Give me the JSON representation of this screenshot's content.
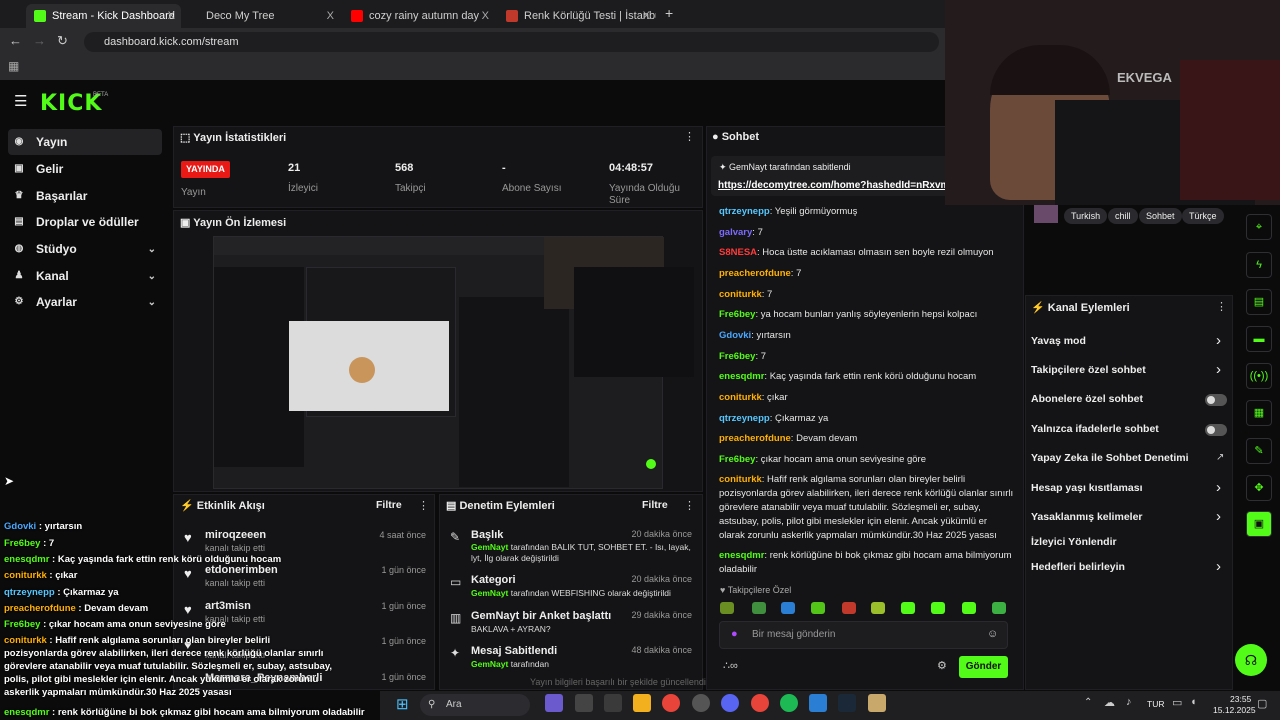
{
  "browser": {
    "tabs": [
      {
        "label": "Stream - Kick Dashboard",
        "close": "X"
      },
      {
        "label": "Deco My Tree",
        "close": "X"
      },
      {
        "label": "cozy rainy autumn day",
        "close": "X"
      },
      {
        "label": "Renk Körlüğü Testi | İstanbul Gö",
        "close": "X"
      }
    ],
    "new_tab": "+",
    "url": "dashboard.kick.com/stream"
  },
  "kick": {
    "logo": "KICK",
    "beta": "BETA",
    "sidebar": [
      {
        "label": "Yayın",
        "icon": "stream-icon"
      },
      {
        "label": "Gelir",
        "icon": "revenue-icon"
      },
      {
        "label": "Başarılar",
        "icon": "trophy-icon"
      },
      {
        "label": "Droplar ve ödüller",
        "icon": "gift-icon"
      },
      {
        "label": "Stüdyo",
        "icon": "studio-icon"
      },
      {
        "label": "Kanal",
        "icon": "channel-icon"
      },
      {
        "label": "Ayarlar",
        "icon": "settings-icon"
      }
    ],
    "stats": {
      "title": "Yayın İstatistikleri",
      "live_badge": "YAYINDA",
      "items": [
        {
          "value": "",
          "label": "Yayın"
        },
        {
          "value": "21",
          "label": "İzleyici"
        },
        {
          "value": "568",
          "label": "Takipçi"
        },
        {
          "value": "-",
          "label": "Abone Sayısı"
        },
        {
          "value": "04:48:57",
          "label": "Yayında Olduğu Süre"
        }
      ]
    },
    "preview": {
      "title": "Yayın Ön İzlemesi"
    },
    "activity": {
      "title": "Etkinlik Akışı",
      "filter": "Filtre",
      "events": [
        {
          "name": "miroqzeeen",
          "sub": "kanalı takip etti",
          "time": "4 saat önce"
        },
        {
          "name": "etdonerimben",
          "sub": "kanalı takip etti",
          "time": "1 gün önce"
        },
        {
          "name": "art3misn",
          "sub": "kanalı takip etti",
          "time": "1 gün önce"
        },
        {
          "name": "",
          "sub": "kanalı takip etti",
          "time": "1 gün önce"
        },
        {
          "name": "Marmara_Peynamberli",
          "sub": "",
          "time": "1 gün önce"
        }
      ]
    },
    "moderation": {
      "title": "Denetim Eylemleri",
      "filter": "Filtre",
      "items": [
        {
          "title": "Başlık",
          "actor": "GemNayt",
          "text": "tarafından BALIK TUT, SOHBET ET. - Isı, layak, lyt, İlg olarak değiştirildi",
          "time": "20 dakika önce"
        },
        {
          "title": "Kategori",
          "actor": "GemNayt",
          "text": "tarafından WEBFISHING olarak değiştirildi",
          "time": "20 dakika önce"
        },
        {
          "title": "GemNayt bir Anket başlattı",
          "actor": "",
          "text": "BAKLAVA + AYRAN?",
          "time": "29 dakika önce"
        },
        {
          "title": "Mesaj Sabitlendi",
          "actor": "GemNayt",
          "text": "tarafından",
          "time": "48 dakika önce"
        }
      ],
      "toast": "Yayın bilgileri başarılı bir şekilde güncellendi."
    },
    "chat": {
      "title": "Sohbet",
      "pinned_by": "GemNayt tarafından sabitlendi",
      "pinned_link": "https://decomytree.com/home?hashedId=nRxvmR",
      "messages": [
        {
          "user": "qtrzeynepp",
          "color": "#56c8ff",
          "text": "Yeşili görmüyormuş"
        },
        {
          "user": "galvary",
          "color": "#7b6bff",
          "text": "7"
        },
        {
          "user": "S8NESA",
          "color": "#ff3b3b",
          "text": "Hoca üstte acıklaması olmasın sen boyle rezil olmuyon"
        },
        {
          "user": "preacherofdune",
          "color": "#ffb000",
          "text": "7"
        },
        {
          "user": "coniturkk",
          "color": "#ffb000",
          "text": "7"
        },
        {
          "user": "Fre6bey",
          "color": "#53fc18",
          "text": "ya hocam bunları yanlış söyleyenlerin hepsi kolpacı"
        },
        {
          "user": "Gdovki",
          "color": "#4aa8ff",
          "text": "yırtarsın"
        },
        {
          "user": "Fre6bey",
          "color": "#53fc18",
          "text": "7"
        },
        {
          "user": "enesqdmr",
          "color": "#53fc18",
          "text": "Kaç yaşında fark ettin renk körü olduğunu hocam"
        },
        {
          "user": "coniturkk",
          "color": "#ffb000",
          "text": "çıkar"
        },
        {
          "user": "qtrzeynepp",
          "color": "#56c8ff",
          "text": "Çıkarmaz ya"
        },
        {
          "user": "preacherofdune",
          "color": "#ffb000",
          "text": "Devam devam"
        },
        {
          "user": "Fre6bey",
          "color": "#53fc18",
          "text": "çıkar hocam ama onun seviyesine göre"
        },
        {
          "user": "coniturkk",
          "color": "#ffb000",
          "text": "Hafif renk algılama sorunları olan bireyler belirli pozisyonlarda görev alabilirken, ileri derece renk körlüğü olanlar sınırlı görevlere atanabilir veya muaf tutulabilir. Sözleşmeli er, subay, astsubay, polis, pilot gibi meslekler için elenir. Ancak yükümlü er olarak zorunlu askerlik yapmaları mümkündür.30 Haz 2025 yasası"
        },
        {
          "user": "enesqdmr",
          "color": "#53fc18",
          "text": "renk körlüğüne bi bok çıkmaz gibi hocam ama bilmiyorum oladabilir"
        }
      ],
      "followers_only": "Takipçilere Özel",
      "input_placeholder": "Bir mesaj gönderin",
      "send": "Gönder"
    },
    "tags": [
      "Turkish",
      "chill",
      "Sohbet",
      "Türkçe"
    ],
    "channel_actions": {
      "title": "Kanal Eylemleri",
      "items": [
        {
          "label": "Yavaş mod",
          "control": "arrow"
        },
        {
          "label": "Takipçilere özel sohbet",
          "control": "arrow"
        },
        {
          "label": "Abonelere özel sohbet",
          "control": "toggle"
        },
        {
          "label": "Yalnızca ifadelerle sohbet",
          "control": "toggle"
        },
        {
          "label": "Yapay Zeka ile Sohbet Denetimi",
          "control": "external"
        },
        {
          "label": "Hesap yaşı kısıtlaması",
          "control": "arrow"
        },
        {
          "label": "Yasaklanmış kelimeler",
          "control": "arrow"
        },
        {
          "label": "İzleyici Yönlendir",
          "control": "none"
        },
        {
          "label": "Hedefleri belirleyin",
          "control": "arrow"
        }
      ]
    }
  },
  "overlay_chat": [
    {
      "user": "Gdovki",
      "color": "#4aa8ff",
      "text": "yırtarsın"
    },
    {
      "user": "Fre6bey",
      "color": "#53fc18",
      "text": "7"
    },
    {
      "user": "enesqdmr",
      "color": "#53fc18",
      "text": "Kaç yaşında fark ettin renk körü olduğunu hocam"
    },
    {
      "user": "coniturkk",
      "color": "#ffb000",
      "text": "çıkar"
    },
    {
      "user": "qtrzeynepp",
      "color": "#56c8ff",
      "text": "Çıkarmaz ya"
    },
    {
      "user": "preacherofdune",
      "color": "#ffb000",
      "text": "Devam devam"
    },
    {
      "user": "Fre6bey",
      "color": "#53fc18",
      "text": "çıkar hocam ama onun seviyesine göre"
    },
    {
      "user": "coniturkk",
      "color": "#ffb000",
      "text": "Hafif renk algılama sorunları olan bireyler belirli pozisyonlarda görev alabilirken, ileri derece renk körlüğü olanlar sınırlı görevlere atanabilir veya muaf tutulabilir. Sözleşmeli er, subay, astsubay, polis, pilot gibi meslekler için elenir. Ancak yükümlü er olarak zorunlu askerlik yapmaları mümkündür.30 Haz 2025 yasası"
    },
    {
      "user": "enesqdmr",
      "color": "#53fc18",
      "text": "renk körlüğüne bi bok çıkmaz gibi hocam ama bilmiyorum oladabilir"
    }
  ],
  "webcam": {
    "shirt_text": "EKVEGA"
  },
  "taskbar": {
    "search": "Ara",
    "lang": "TUR",
    "time": "23:55",
    "date": "15.12.2025"
  },
  "colors": {
    "accent": "#53fc18",
    "live": "#e91916"
  }
}
